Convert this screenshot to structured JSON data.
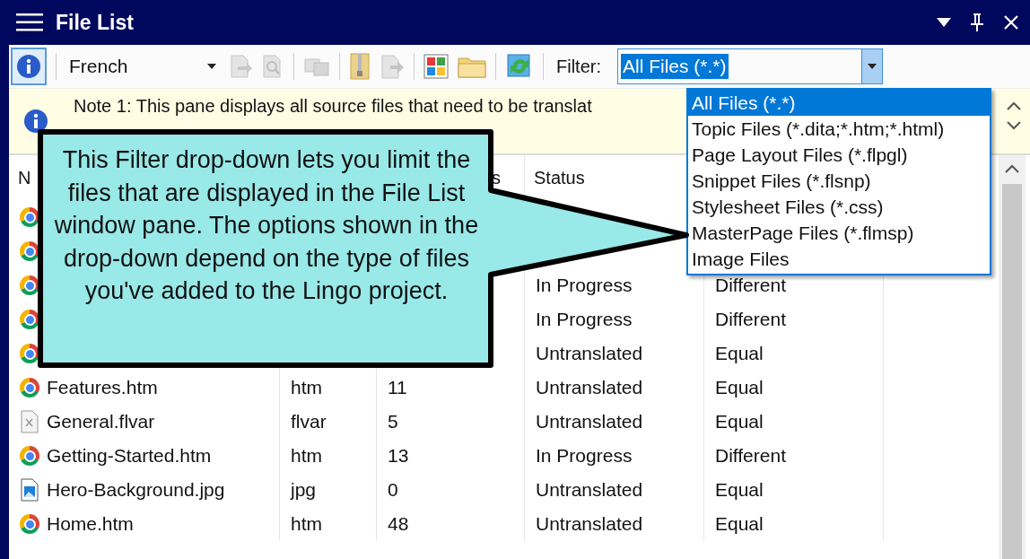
{
  "window": {
    "title": "File List"
  },
  "toolbar": {
    "language": "French",
    "filter_label": "Filter:",
    "filter_value": "All Files (*.*)"
  },
  "note": {
    "text": "Note 1: This pane displays all source files that need to be translat"
  },
  "table": {
    "columns": [
      "N",
      "",
      "s",
      "Status",
      ""
    ],
    "rows": [
      {
        "kind": "browser"
      },
      {
        "kind": "browser"
      },
      {
        "kind": "browser",
        "status": "In Progress",
        "comparison": "Different"
      },
      {
        "kind": "browser",
        "status": "In Progress",
        "comparison": "Different"
      },
      {
        "kind": "browser",
        "status": "Untranslated",
        "comparison": "Equal"
      },
      {
        "kind": "browser",
        "name": "Features.htm",
        "type": "htm",
        "count": "11",
        "status": "Untranslated",
        "comparison": "Equal"
      },
      {
        "kind": "variable",
        "name": "General.flvar",
        "type": "flvar",
        "count": "5",
        "status": "Untranslated",
        "comparison": "Equal"
      },
      {
        "kind": "browser",
        "name": "Getting-Started.htm",
        "type": "htm",
        "count": "13",
        "status": "In Progress",
        "comparison": "Different"
      },
      {
        "kind": "image",
        "name": "Hero-Background.jpg",
        "type": "jpg",
        "count": "0",
        "status": "Untranslated",
        "comparison": "Equal"
      },
      {
        "kind": "browser",
        "name": "Home.htm",
        "type": "htm",
        "count": "48",
        "status": "Untranslated",
        "comparison": "Equal"
      }
    ]
  },
  "filter_dropdown": {
    "options": [
      {
        "label": "All Files (*.*)",
        "selected": true
      },
      {
        "label": "Topic Files (*.dita;*.htm;*.html)",
        "selected": false
      },
      {
        "label": "Page Layout Files (*.flpgl)",
        "selected": false
      },
      {
        "label": "Snippet Files (*.flsnp)",
        "selected": false
      },
      {
        "label": "Stylesheet Files (*.css)",
        "selected": false
      },
      {
        "label": "MasterPage Files (*.flmsp)",
        "selected": false
      },
      {
        "label": "Image Files",
        "selected": false
      }
    ]
  },
  "callout": {
    "text": "This Filter drop-down lets you limit the files that are displayed in the File List window pane. The options shown in the drop-down depend on the type of files you've added to the Lingo project."
  }
}
